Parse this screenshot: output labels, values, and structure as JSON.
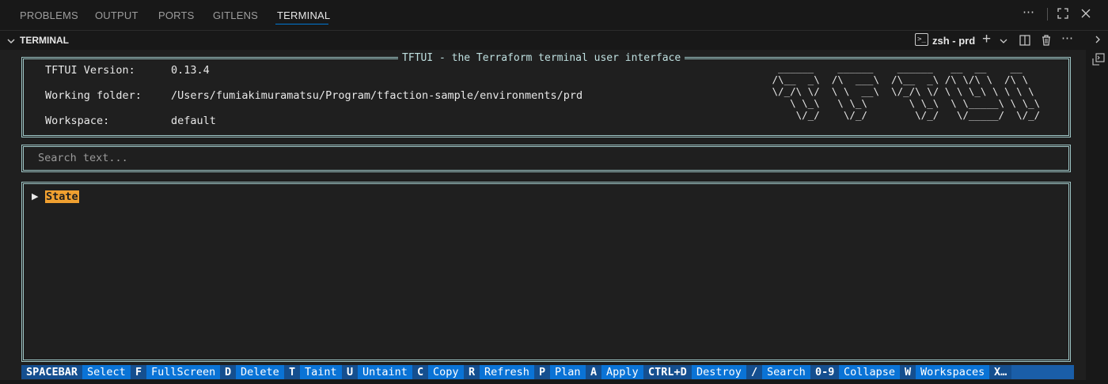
{
  "panel_tabs": [
    "PROBLEMS",
    "OUTPUT",
    "PORTS",
    "GITLENS",
    "TERMINAL"
  ],
  "active_tab": "TERMINAL",
  "terminal_header": {
    "title": "TERMINAL",
    "shell_label": "zsh - prd"
  },
  "icons": {
    "more": "ellipsis-icon",
    "maximize": "maximize-panel-icon",
    "close": "close-icon",
    "add": "plus-icon",
    "split": "split-terminal-icon",
    "trash": "trash-icon",
    "collapse": "chevron-down-icon"
  },
  "app": {
    "title": "TFTUI - the Terraform terminal user interface",
    "info": [
      {
        "label": "TFTUI Version:",
        "value": "0.13.4"
      },
      {
        "label": "Working folder:",
        "value": "/Users/fumiakimuramatsu/Program/tfaction-sample/environments/prd"
      },
      {
        "label": "Workspace:",
        "value": "default"
      }
    ],
    "search_placeholder": "Search text...",
    "tree_root": "State"
  },
  "footer": [
    {
      "key": "SPACEBAR",
      "desc": "Select"
    },
    {
      "key": "F",
      "desc": "FullScreen"
    },
    {
      "key": "D",
      "desc": "Delete"
    },
    {
      "key": "T",
      "desc": "Taint"
    },
    {
      "key": "U",
      "desc": "Untaint"
    },
    {
      "key": "C",
      "desc": "Copy"
    },
    {
      "key": "R",
      "desc": "Refresh"
    },
    {
      "key": "P",
      "desc": "Plan"
    },
    {
      "key": "A",
      "desc": "Apply"
    },
    {
      "key": "CTRL+D",
      "desc": "Destroy"
    },
    {
      "key": "/",
      "desc": "Search"
    },
    {
      "key": "0-9",
      "desc": "Collapse"
    },
    {
      "key": "W",
      "desc": "Workspaces"
    },
    {
      "key": "X…",
      "desc": ""
    }
  ],
  "colors": {
    "border": "#9fc7c7",
    "highlight": "#f0a030",
    "footer_key": "#154f8f",
    "footer_desc": "#0a73d6"
  }
}
